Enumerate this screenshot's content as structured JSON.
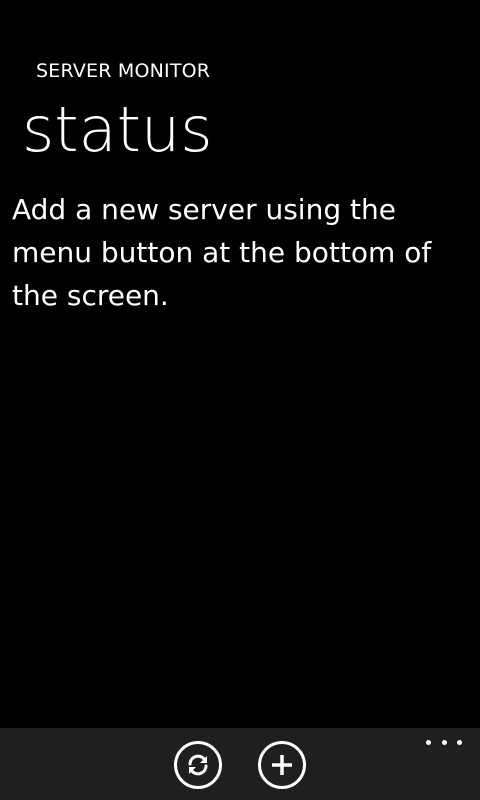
{
  "app": {
    "title": "SERVER MONITOR",
    "page_title": "status"
  },
  "main": {
    "message": "Add a new server using the menu button at the bottom of the screen."
  },
  "app_bar": {
    "buttons": [
      {
        "icon": "refresh-icon"
      },
      {
        "icon": "add-icon"
      }
    ],
    "more_icon": "ellipsis-icon"
  },
  "colors": {
    "background": "#000000",
    "text": "#ffffff",
    "app_bar": "#1f1f1f"
  }
}
